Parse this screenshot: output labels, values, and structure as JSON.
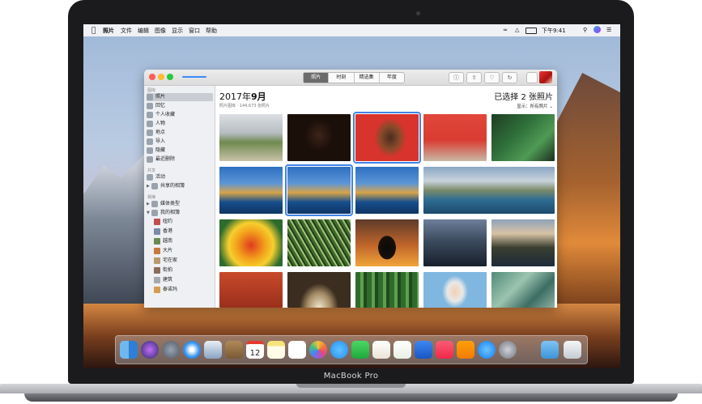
{
  "menubar": {
    "apple": "",
    "items": [
      "照片",
      "文件",
      "编辑",
      "图像",
      "显示",
      "窗口",
      "帮助"
    ],
    "clock": "下午9:41",
    "status_icons": [
      "wifi-icon",
      "airplay-icon",
      "battery-icon",
      "spotlight-icon",
      "siri-icon",
      "notification-icon"
    ]
  },
  "toolbar": {
    "tabs": [
      "照片",
      "时刻",
      "精选集",
      "年度"
    ],
    "active_tab": "照片",
    "buttons": [
      "info-icon",
      "share-icon",
      "heart-icon",
      "rotate-icon",
      "search-icon"
    ]
  },
  "sidebar": {
    "library_header": "图库",
    "library_items": [
      {
        "label": "照片",
        "icon": "photos-icon",
        "selected": true
      },
      {
        "label": "回忆",
        "icon": "memories-icon"
      },
      {
        "label": "个人收藏",
        "icon": "heart-icon"
      },
      {
        "label": "人物",
        "icon": "people-icon"
      },
      {
        "label": "地点",
        "icon": "pin-icon"
      },
      {
        "label": "导入",
        "icon": "import-icon"
      },
      {
        "label": "隐藏",
        "icon": "hidden-icon"
      },
      {
        "label": "最近删除",
        "icon": "trash-icon"
      }
    ],
    "shared_header": "共享",
    "shared_items": [
      {
        "label": "活动",
        "icon": "cloud-icon"
      },
      {
        "label": "共享的相簿",
        "icon": "shared-album-icon"
      }
    ],
    "albums_header": "相簿",
    "album_items": [
      {
        "label": "媒体类型",
        "icon": "folder-icon"
      },
      {
        "label": "我的相簿",
        "icon": "folder-icon"
      }
    ],
    "my_albums": [
      "纽约",
      "香港",
      "越南",
      "大片",
      "宅在家",
      "街拍",
      "建筑",
      "泰诺玛"
    ]
  },
  "main": {
    "month": "2017年",
    "month_bold": "9月",
    "subtitle": "照片图库 · 144,673 张照片",
    "selection": "已选择 2 张照片",
    "show_label": "显示：",
    "show_value": "所有照片 ⌄",
    "photo_count_visible": 20
  },
  "dock": {
    "apps": [
      "finder-icon",
      "siri-icon",
      "launchpad-icon",
      "safari-icon",
      "mail-icon",
      "contacts-icon",
      "calendar-icon",
      "notes-icon",
      "reminders-icon",
      "photos-icon",
      "messages-icon",
      "facetime-icon",
      "pages-icon",
      "numbers-icon",
      "keynote-icon",
      "music-icon",
      "books-icon",
      "appstore-icon",
      "settings-icon",
      "downloads-icon",
      "trash-icon"
    ],
    "calendar_date": "12"
  },
  "laptop": {
    "model": "MacBook Pro"
  },
  "colors": {
    "accent": "#3f84e8",
    "close": "#fc5d57",
    "minimize": "#fdbb2e",
    "maximize": "#28c840"
  }
}
